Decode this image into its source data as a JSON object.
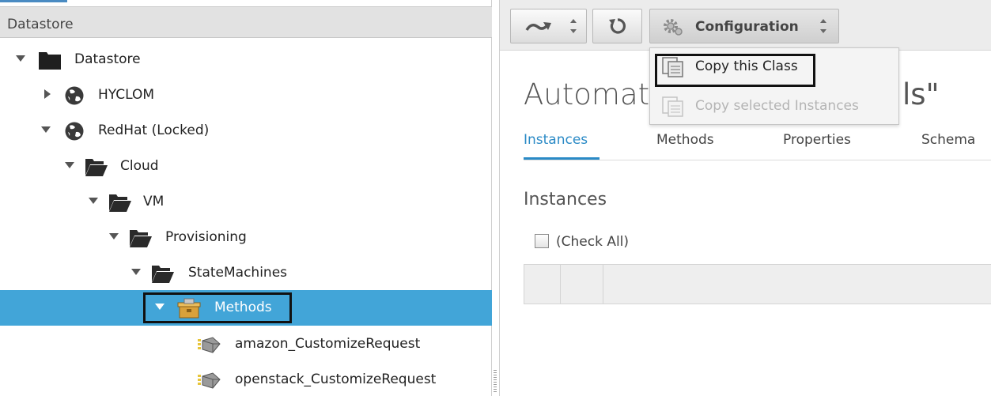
{
  "left_panel": {
    "header": "Datastore",
    "tree": [
      {
        "label": "Datastore",
        "icon": "folder-icon"
      },
      {
        "label": "HYCLOM",
        "icon": "globe-icon"
      },
      {
        "label": "RedHat (Locked)",
        "icon": "globe-icon"
      },
      {
        "label": "Cloud",
        "icon": "open-folder-icon"
      },
      {
        "label": "VM",
        "icon": "open-folder-icon"
      },
      {
        "label": "Provisioning",
        "icon": "open-folder-icon"
      },
      {
        "label": "StateMachines",
        "icon": "open-folder-icon"
      },
      {
        "label": "Methods",
        "icon": "class-box-icon",
        "selected": true
      },
      {
        "label": "amazon_CustomizeRequest",
        "icon": "instance-icon"
      },
      {
        "label": "openstack_CustomizeRequest",
        "icon": "instance-icon"
      }
    ]
  },
  "toolbar": {
    "configuration_label": "Configuration"
  },
  "dropdown": {
    "copy_class": "Copy this Class",
    "copy_selected": "Copy selected Instances"
  },
  "main": {
    "title_start": "Automat",
    "title_end": "ls\"",
    "tabs": [
      "Instances",
      "Methods",
      "Properties",
      "Schema"
    ],
    "section_title": "Instances",
    "check_all_label": "(Check All)"
  },
  "colors": {
    "selection": "#42a5d8",
    "accent": "#2a8ac6"
  }
}
